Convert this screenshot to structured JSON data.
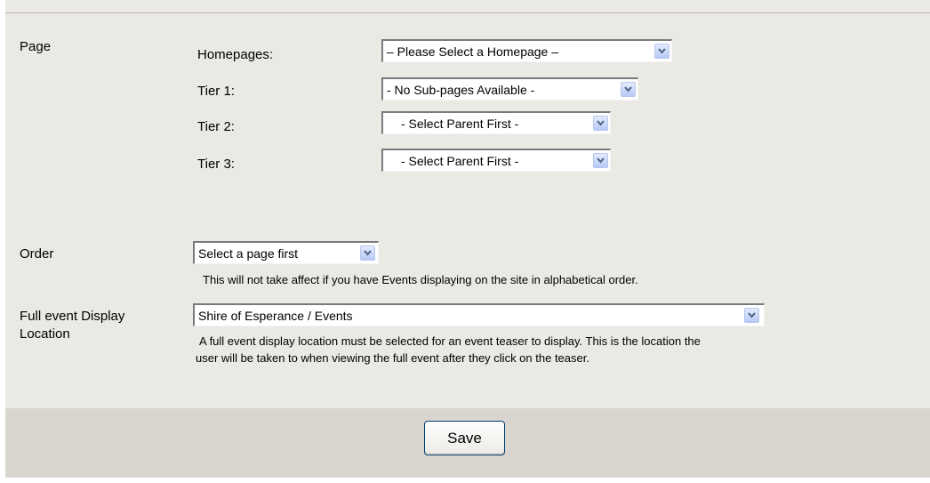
{
  "page_section": {
    "label": "Page",
    "homepages_label": "Homepages:",
    "homepages_value": "– Please Select a Homepage –",
    "tier1_label": "Tier 1:",
    "tier1_value": "- No Sub-pages Available -",
    "tier2_label": "Tier 2:",
    "tier2_value": "- Select Parent First -",
    "tier3_label": "Tier 3:",
    "tier3_value": "- Select Parent First -"
  },
  "order_section": {
    "label": "Order",
    "value": "Select a page first",
    "note": "This will not take affect if you have Events displaying on the site in alphabetical order."
  },
  "display_location_section": {
    "label_line1": "Full event Display",
    "label_line2": "Location",
    "value": "Shire of Esperance / Events",
    "note_line1": "A full event display location must be selected for an event teaser to display. This is the location the",
    "note_line2": "user will be taken to when viewing the full event after they click on the teaser."
  },
  "footer": {
    "save_label": "Save"
  },
  "icons": {
    "dropdown_arrow": "chevron-down-icon"
  }
}
